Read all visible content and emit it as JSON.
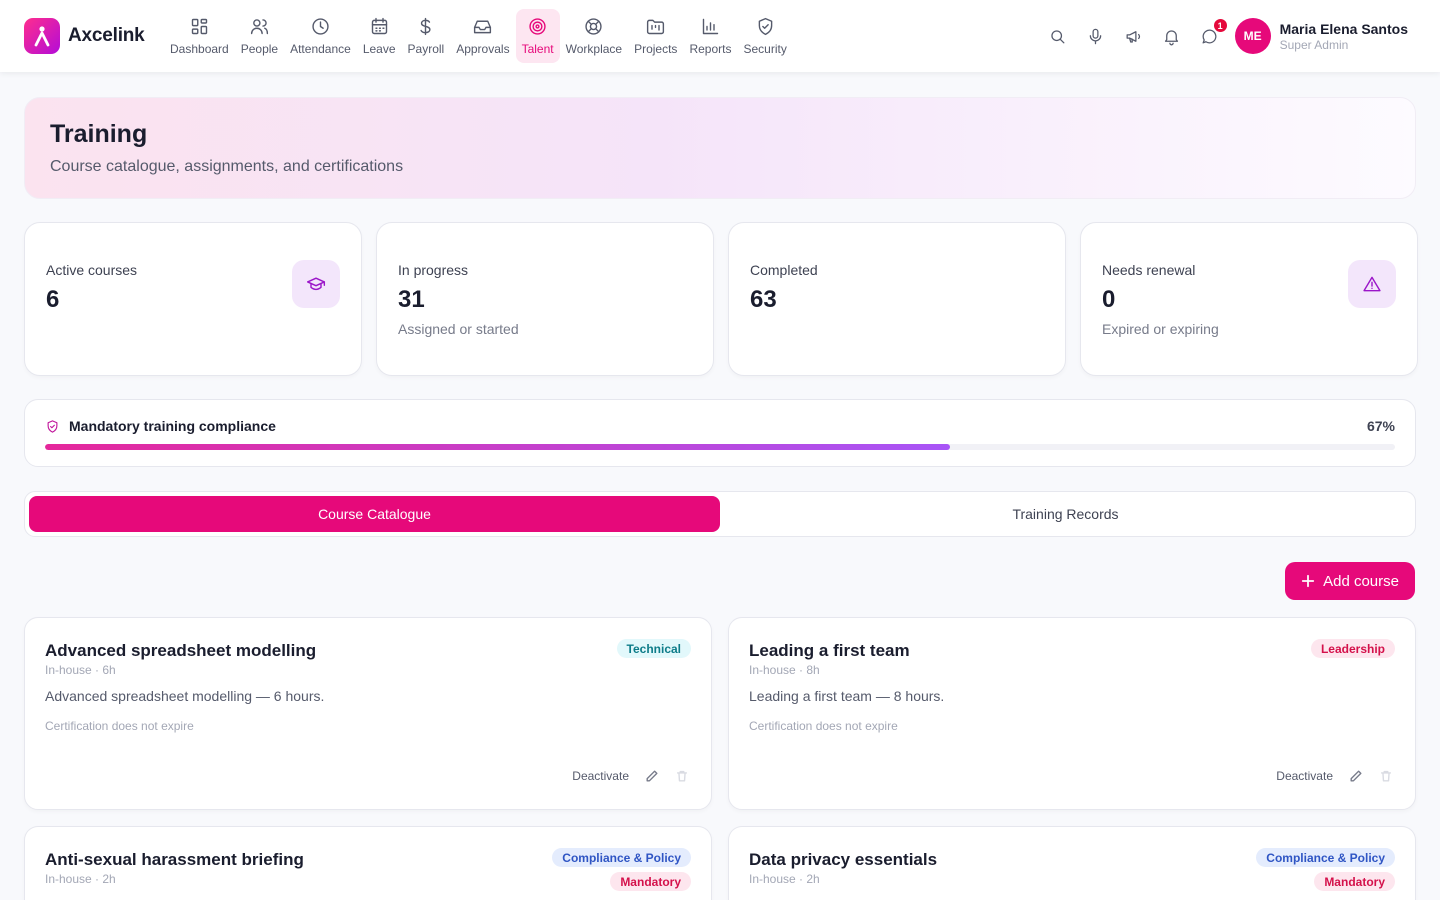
{
  "app": {
    "name": "Axcelink"
  },
  "nav": [
    {
      "label": "Dashboard",
      "icon": "dashboard-icon"
    },
    {
      "label": "People",
      "icon": "people-icon"
    },
    {
      "label": "Attendance",
      "icon": "clock-icon"
    },
    {
      "label": "Leave",
      "icon": "calendar-icon"
    },
    {
      "label": "Payroll",
      "icon": "dollar-icon"
    },
    {
      "label": "Approvals",
      "icon": "inbox-icon"
    },
    {
      "label": "Talent",
      "icon": "target-icon",
      "active": true
    },
    {
      "label": "Workplace",
      "icon": "lifebuoy-icon"
    },
    {
      "label": "Projects",
      "icon": "folder-kanban-icon"
    },
    {
      "label": "Reports",
      "icon": "bar-chart-icon"
    },
    {
      "label": "Security",
      "icon": "shield-icon"
    }
  ],
  "header": {
    "notification_count": "1",
    "user": {
      "initials": "ME",
      "name": "Maria Elena Santos",
      "role": "Super Admin"
    }
  },
  "page": {
    "title": "Training",
    "subtitle": "Course catalogue, assignments, and certifications"
  },
  "stats": [
    {
      "label": "Active courses",
      "value": "6",
      "sub": "",
      "icon": "graduation-cap-icon"
    },
    {
      "label": "In progress",
      "value": "31",
      "sub": "Assigned or started"
    },
    {
      "label": "Completed",
      "value": "63",
      "sub": ""
    },
    {
      "label": "Needs renewal",
      "value": "0",
      "sub": "Expired or expiring",
      "icon": "alert-triangle-icon"
    }
  ],
  "compliance": {
    "title": "Mandatory training compliance",
    "percent_label": "67%",
    "percent": 67
  },
  "tabs": [
    {
      "label": "Course Catalogue",
      "active": true
    },
    {
      "label": "Training Records"
    }
  ],
  "add_button": "Add course",
  "courses": [
    {
      "title": "Advanced spreadsheet modelling",
      "meta": "In-house · 6h",
      "description": "Advanced spreadsheet modelling — 6 hours.",
      "certification": "Certification does not expire",
      "category": "Technical",
      "deactivate": "Deactivate"
    },
    {
      "title": "Leading a first team",
      "meta": "In-house · 8h",
      "description": "Leading a first team — 8 hours.",
      "certification": "Certification does not expire",
      "category": "Leadership",
      "deactivate": "Deactivate"
    },
    {
      "title": "Anti-sexual harassment briefing",
      "meta": "In-house · 2h",
      "category": "Compliance & Policy",
      "mandatory": "Mandatory"
    },
    {
      "title": "Data privacy essentials",
      "meta": "In-house · 2h",
      "category": "Compliance & Policy",
      "mandatory": "Mandatory"
    }
  ],
  "colors": {
    "accent": "#e6097a",
    "icon_purple": "#9b16c9",
    "progress_start": "#e5279b",
    "progress_end": "#a855f7"
  }
}
